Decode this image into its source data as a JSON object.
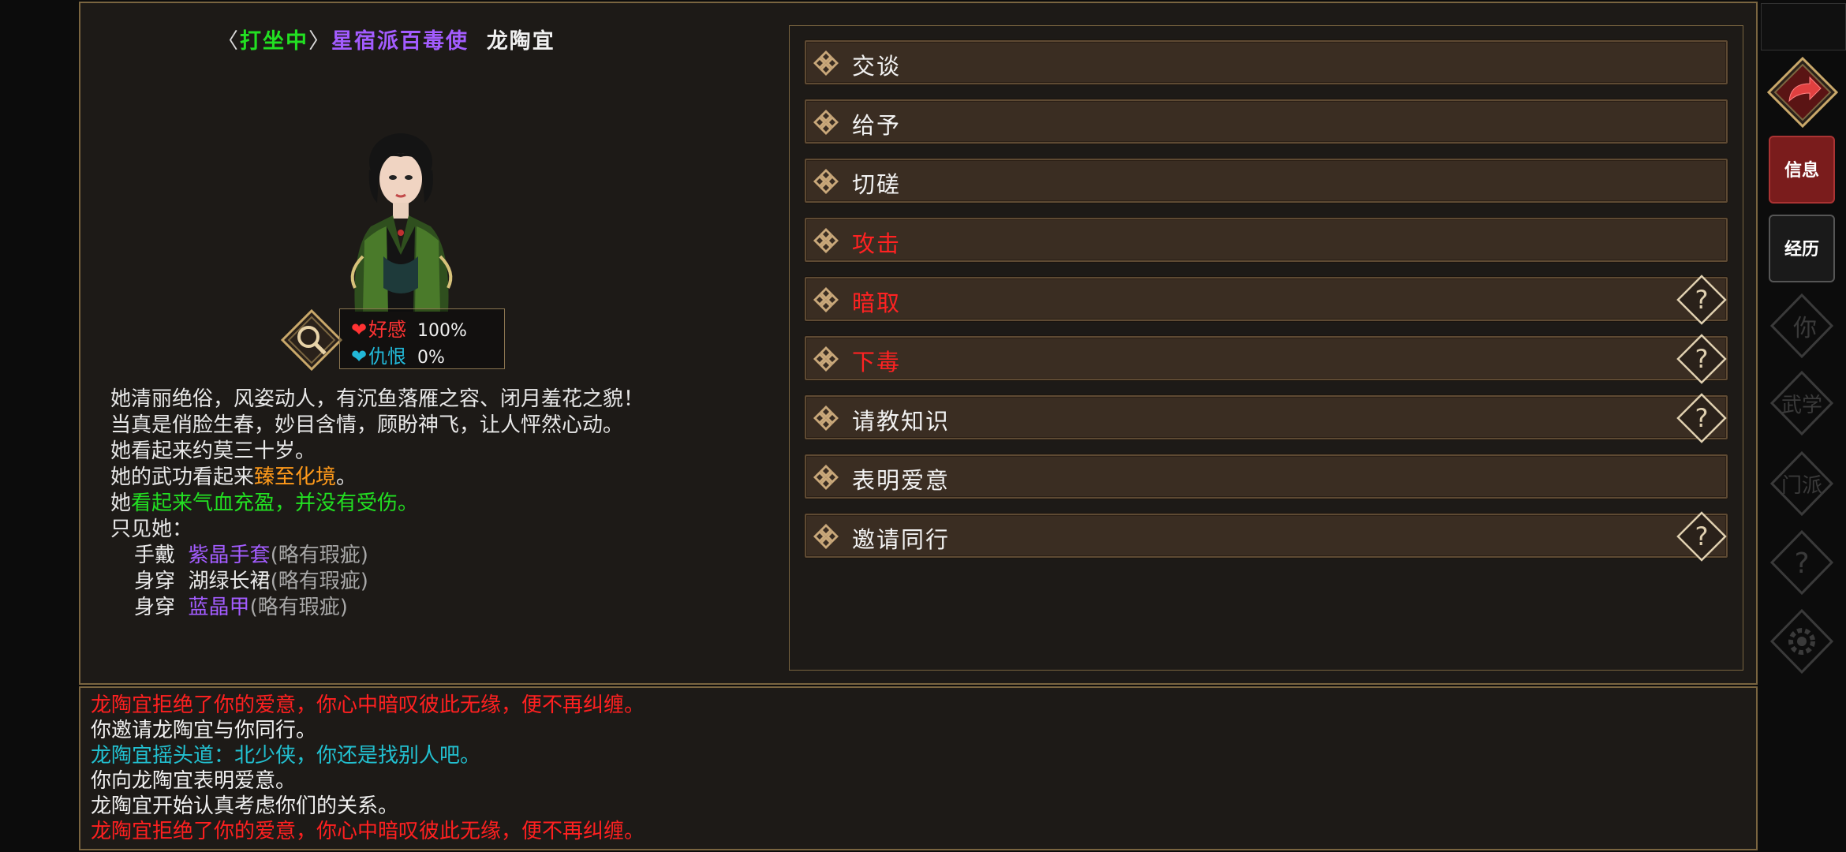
{
  "header": {
    "status": "打坐中",
    "title": "星宿派百毒使",
    "name": "龙陶宜",
    "colors": {
      "status": "#22e022",
      "title": "#a35cff",
      "name": "#f0f0f0"
    }
  },
  "relation": {
    "favor_label": "好感",
    "favor_value": "100%",
    "hatred_label": "仇恨",
    "hatred_value": "0%",
    "colors": {
      "favor": "#ff3333",
      "hatred": "#22b8d8"
    }
  },
  "description": {
    "line1": "她清丽绝俗，风姿动人，有沉鱼落雁之容、闭月羞花之貌！",
    "line2": "当真是俏脸生春，妙目含情，顾盼神飞，让人怦然心动。",
    "line3": "她看起来约莫三十岁。",
    "line4_prefix": "她的武功看起来",
    "line4_level": "臻至化境",
    "line4_suffix": "。",
    "line5_prefix": "她",
    "line5_status": "看起来气血充盈，并没有受伤。",
    "line6": "只见她：",
    "equipment": [
      {
        "slot": "手戴",
        "item": "紫晶手套",
        "cond": "(略有瑕疵)"
      },
      {
        "slot": "身穿",
        "item": "湖绿长裙",
        "cond": "(略有瑕疵)"
      },
      {
        "slot": "身穿",
        "item": "蓝晶甲",
        "cond": "(略有瑕疵)"
      }
    ],
    "colors": {
      "level": "#ff9a1a",
      "healthy": "#22e022",
      "item_purple": "#a35cff"
    }
  },
  "actions": [
    {
      "label": "交谈",
      "color": "white",
      "help": false
    },
    {
      "label": "给予",
      "color": "white",
      "help": false
    },
    {
      "label": "切磋",
      "color": "white",
      "help": false
    },
    {
      "label": "攻击",
      "color": "red",
      "help": false
    },
    {
      "label": "暗取",
      "color": "red",
      "help": true
    },
    {
      "label": "下毒",
      "color": "red",
      "help": true
    },
    {
      "label": "请教知识",
      "color": "white",
      "help": true
    },
    {
      "label": "表明爱意",
      "color": "white",
      "help": false
    },
    {
      "label": "邀请同行",
      "color": "white",
      "help": true
    }
  ],
  "log": [
    {
      "text": "龙陶宜拒绝了你的爱意，你心中暗叹彼此无缘，便不再纠缠。",
      "color": "#ff2020"
    },
    {
      "text": "你邀请龙陶宜与你同行。",
      "color": "#f0f0f0"
    },
    {
      "text": "龙陶宜摇头道：北少侠，你还是找别人吧。",
      "color": "#22c0d0"
    },
    {
      "text": "你向龙陶宜表明爱意。",
      "color": "#f0f0f0"
    },
    {
      "text": "龙陶宜开始认真考虑你们的关系。",
      "color": "#f0f0f0"
    },
    {
      "text": "龙陶宜拒绝了你的爱意，你心中暗叹彼此无缘，便不再纠缠。",
      "color": "#ff2020"
    }
  ],
  "sidebar": {
    "tab_info": "信息",
    "tab_experience": "经历",
    "faint_tabs": [
      "你",
      "武学",
      "门派"
    ]
  }
}
